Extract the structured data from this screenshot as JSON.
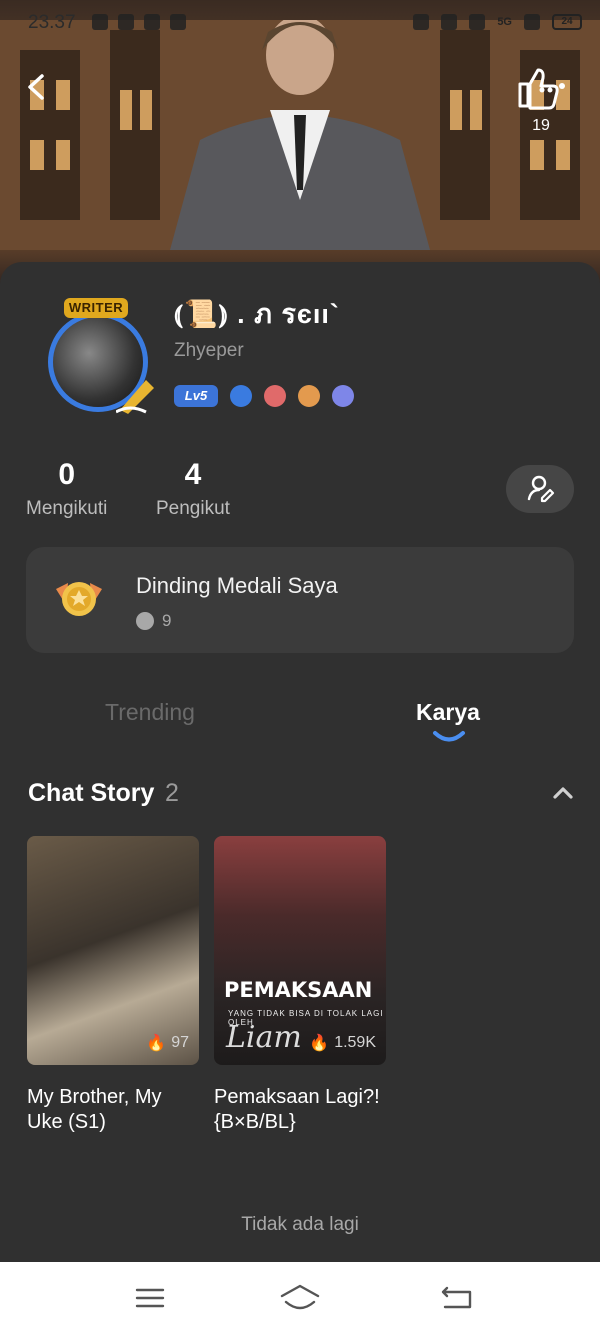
{
  "status_bar": {
    "time": "23.37",
    "battery": "24",
    "network": "5G"
  },
  "header": {
    "like_count": "19"
  },
  "profile": {
    "username": "⦅📜⦆ . ภ รєıı`",
    "handle": "Zhyeper",
    "level": "Lv5",
    "writer_tag": "WRITER"
  },
  "stats": {
    "following_count": "0",
    "following_label": "Mengikuti",
    "followers_count": "4",
    "followers_label": "Pengikut"
  },
  "medal": {
    "title": "Dinding Medali Saya",
    "count": "9"
  },
  "tabs": [
    {
      "label": "Trending",
      "active": false
    },
    {
      "label": "Karya",
      "active": true
    }
  ],
  "section": {
    "title": "Chat Story",
    "count": "2"
  },
  "stories": [
    {
      "title": "My Brother, My Uke (S1)",
      "reads": "97"
    },
    {
      "title": "Pemaksaan Lagi?! {B×B/BL}",
      "reads": "1.59K",
      "cover_text": "PEMAKSAAN",
      "cover_sub": "YANG TIDAK BISA DI TOLAK LAGI OLEH",
      "cover_sig": "Liam"
    }
  ],
  "footer": {
    "end_text": "Tidak ada lagi"
  },
  "colors": {
    "background": "#303030",
    "card": "#3b3b3b",
    "accent": "#3a7be0",
    "level_badge": "#3c74d8"
  }
}
